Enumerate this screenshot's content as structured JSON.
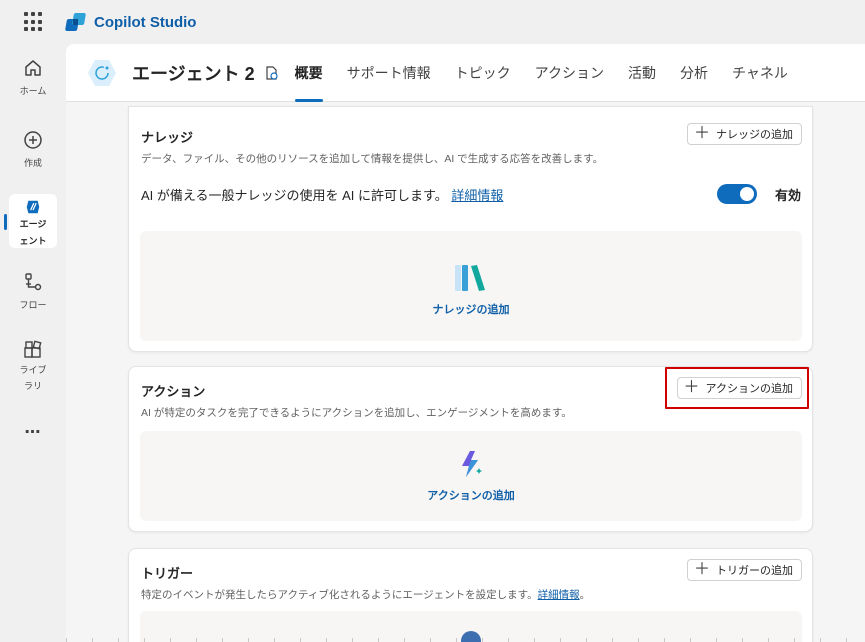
{
  "app": {
    "title": "Copilot Studio"
  },
  "rail": {
    "items": [
      {
        "label": "ホーム",
        "icon": "home-icon"
      },
      {
        "label": "作成",
        "icon": "plus-circle-icon"
      },
      {
        "label_line1": "エージ",
        "label_line2": "ェント",
        "icon": "agent-icon"
      },
      {
        "label": "フロー",
        "icon": "flow-icon"
      },
      {
        "label_line1": "ライブ",
        "label_line2": "ラリ",
        "icon": "library-icon"
      },
      {
        "label": "…",
        "icon": "more-icon"
      }
    ]
  },
  "header": {
    "agent_name": "エージェント 2",
    "tabs": [
      "概要",
      "サポート情報",
      "トピック",
      "アクション",
      "活動",
      "分析",
      "チャネル"
    ],
    "active_tab": "概要"
  },
  "knowledge": {
    "title": "ナレッジ",
    "desc": "データ、ファイル、その他のリソースを追加して情報を提供し、AI で生成する応答を改善します。",
    "add_label": "ナレッジの追加",
    "toggle_text": "AI が備える一般ナレッジの使用を AI に許可します。",
    "toggle_link": "詳細情報",
    "toggle_state": "有効",
    "toggle_on": true,
    "empty_label": "ナレッジの追加"
  },
  "actions": {
    "title": "アクション",
    "desc": "AI が特定のタスクを完了できるようにアクションを追加し、エンゲージメントを高めます。",
    "add_label": "アクションの追加",
    "empty_label": "アクションの追加"
  },
  "triggers": {
    "title": "トリガー",
    "desc": "特定のイベントが発生したらアクティブ化されるようにエージェントを設定します。",
    "desc_link": "詳細情報",
    "desc_end": "。",
    "add_label": "トリガーの追加"
  },
  "colors": {
    "accent": "#0f6cbd",
    "link": "#0f5fa8",
    "highlight": "#d00000"
  }
}
